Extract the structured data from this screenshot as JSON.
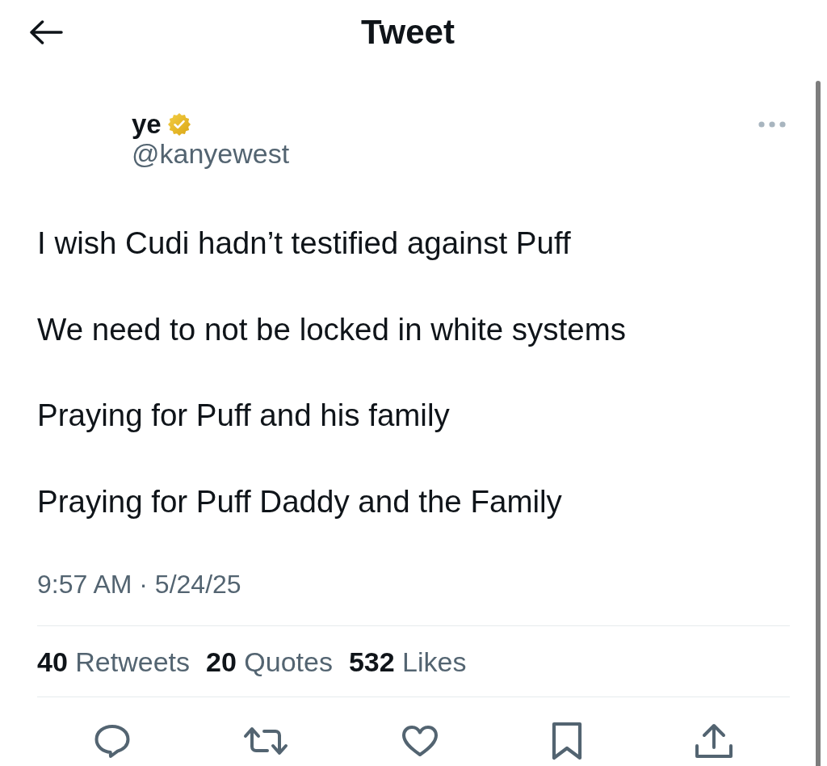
{
  "header": {
    "title": "Tweet"
  },
  "tweet": {
    "author": {
      "name": "ye",
      "verified": true,
      "handle": "@kanyewest"
    },
    "paragraphs": [
      "I wish Cudi hadn’t testified against Puff",
      "We need to not be locked in white systems",
      "Praying for Puff and his family",
      "Praying for Puff Daddy and the Family"
    ],
    "timestamp": "9:57 AM · 5/24/25",
    "stats": [
      {
        "count": "40",
        "label": "Retweets"
      },
      {
        "count": "20",
        "label": "Quotes"
      },
      {
        "count": "532",
        "label": "Likes"
      }
    ]
  },
  "actions": [
    {
      "kind": "reply"
    },
    {
      "kind": "retweet"
    },
    {
      "kind": "like"
    },
    {
      "kind": "bookmark"
    },
    {
      "kind": "share"
    }
  ]
}
